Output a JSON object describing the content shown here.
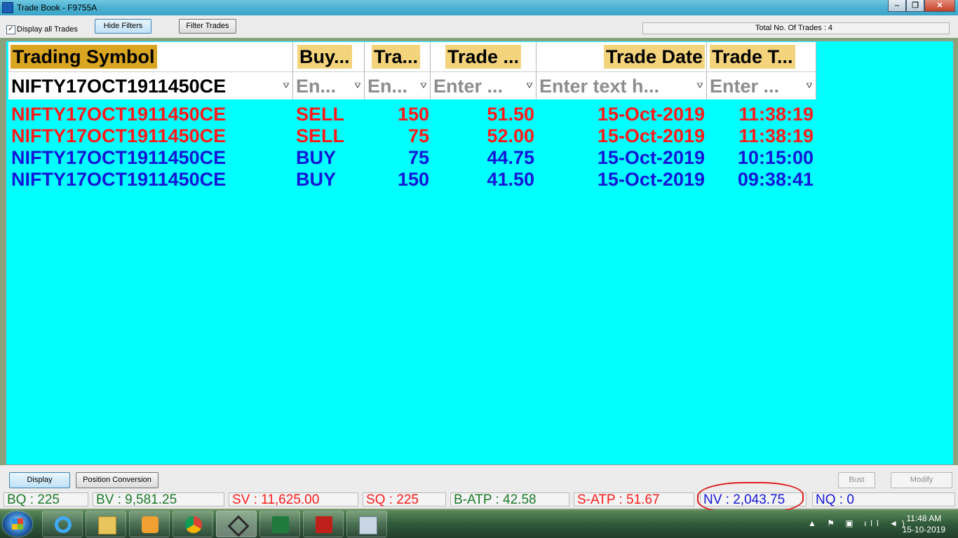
{
  "window": {
    "title": "Trade Book - F9755A",
    "controls": {
      "minimize": "‒",
      "restore": "❐",
      "close": "✕"
    }
  },
  "toolbar": {
    "display_all_label": "Display all Trades",
    "display_all_checked": "✓",
    "hide_filters_label": "Hide Filters",
    "filter_trades_label": "Filter Trades",
    "total_trades": "Total No. Of Trades : 4"
  },
  "grid": {
    "background": "#00ffff",
    "columns": [
      "Trading Symbol",
      "Buy...",
      "Tra...",
      "Trade ...",
      "Trade Date",
      "Trade T..."
    ],
    "filters": [
      "NIFTY17OCT1911450CE",
      "En...",
      "En...",
      "Enter ...",
      "Enter text h...",
      "Enter ..."
    ],
    "rows": [
      {
        "symbol": "NIFTY17OCT1911450CE",
        "side": "SELL",
        "qty": "150",
        "price": "51.50",
        "date": "15-Oct-2019",
        "time": "11:38:19",
        "color": "#ff1a1a"
      },
      {
        "symbol": "NIFTY17OCT1911450CE",
        "side": "SELL",
        "qty": "75",
        "price": "52.00",
        "date": "15-Oct-2019",
        "time": "11:38:19",
        "color": "#ff1a1a"
      },
      {
        "symbol": "NIFTY17OCT1911450CE",
        "side": "BUY",
        "qty": "75",
        "price": "44.75",
        "date": "15-Oct-2019",
        "time": "10:15:00",
        "color": "#1515d8"
      },
      {
        "symbol": "NIFTY17OCT1911450CE",
        "side": "BUY",
        "qty": "150",
        "price": "41.50",
        "date": "15-Oct-2019",
        "time": "09:38:41",
        "color": "#1515d8"
      }
    ]
  },
  "footer": {
    "display_label": "Display",
    "position_conversion_label": "Position Conversion",
    "bust_label": "Bust",
    "modify_label": "Modify"
  },
  "stats": {
    "bq": "BQ : 225",
    "bv": "BV : 9,581.25",
    "sv": "SV : 11,625.00",
    "sq": "SQ : 225",
    "batp": "B-ATP : 42.58",
    "satp": "S-ATP : 51.67",
    "nv": "NV : 2,043.75",
    "nq": "NQ : 0"
  },
  "taskbar": {
    "apps": [
      "internet-explorer-icon",
      "file-explorer-icon",
      "media-player-icon",
      "chrome-icon",
      "trading-terminal-icon",
      "excel-icon",
      "acrobat-reader-icon",
      "calculator-icon"
    ],
    "tray_icons": "▲ ⚑ ▣ ıll ◄)",
    "time": "11:48 AM",
    "date": "15-10-2019"
  }
}
